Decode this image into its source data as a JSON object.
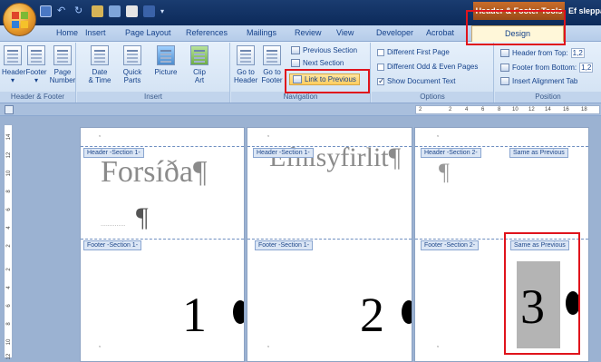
{
  "title_bar": {
    "contextual_tools": "Header & Footer Tools",
    "doc_title_fragment": "Ef sleppa"
  },
  "tabs": [
    "Home",
    "Insert",
    "Page Layout",
    "References",
    "Mailings",
    "Review",
    "View",
    "Developer",
    "Acrobat"
  ],
  "active_tab": "Design",
  "ribbon": {
    "header_footer": {
      "group_label": "Header & Footer",
      "header": "Header",
      "footer": "Footer",
      "page_number_1": "Page",
      "page_number_2": "Number"
    },
    "insert": {
      "group_label": "Insert",
      "date_time_1": "Date",
      "date_time_2": "& Time",
      "quick_parts_1": "Quick",
      "quick_parts_2": "Parts",
      "picture": "Picture",
      "clip_art_1": "Clip",
      "clip_art_2": "Art"
    },
    "navigation": {
      "group_label": "Navigation",
      "go_to_header_1": "Go to",
      "go_to_header_2": "Header",
      "go_to_footer_1": "Go to",
      "go_to_footer_2": "Footer",
      "previous_section": "Previous Section",
      "next_section": "Next Section",
      "link_to_previous": "Link to Previous"
    },
    "options": {
      "group_label": "Options",
      "different_first_page": "Different First Page",
      "different_odd_even": "Different Odd & Even Pages",
      "show_document_text": "Show Document Text",
      "show_document_text_checked": true
    },
    "position": {
      "group_label": "Position",
      "header_from_top": "Header from Top:",
      "header_from_top_value": "1,2",
      "footer_from_bottom": "Footer from Bottom:",
      "footer_from_bottom_value": "1,2",
      "insert_alignment_tab": "Insert Alignment Tab"
    }
  },
  "ruler": {
    "horizontal_ticks": [
      "2",
      "2",
      "4",
      "6",
      "8",
      "10",
      "12",
      "14",
      "16",
      "18"
    ],
    "vertical_ticks": [
      "14",
      "12",
      "10",
      "8",
      "6",
      "4",
      "2",
      "2",
      "4",
      "6",
      "8",
      "10",
      "12"
    ]
  },
  "pages": [
    {
      "header_tag": "Header -Section 1-",
      "body_text": "Forsíða¶",
      "extra_pilcrow": "¶",
      "footer_tag": "Footer -Section 1-",
      "page_number": "1"
    },
    {
      "header_tag": "Header -Section 1-",
      "body_text": "Efnisyfirlit¶",
      "footer_tag": "Footer -Section 1-",
      "page_number": "2"
    },
    {
      "header_tag": "Header -Section 2-",
      "header_same_as_previous": "Same as Previous",
      "body_text": "¶",
      "footer_tag": "Footer -Section 2-",
      "footer_same_as_previous": "Same as Previous",
      "page_number": "3"
    }
  ],
  "colors": {
    "highlight_red": "#e0141c",
    "contextual_tab_orange": "#c86d2a"
  }
}
